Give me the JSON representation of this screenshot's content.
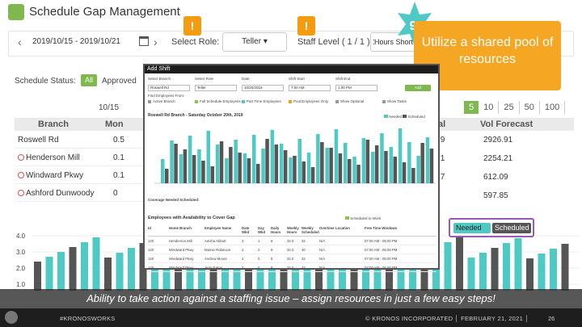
{
  "app": {
    "title": "Schedule Gap Management"
  },
  "toolbar": {
    "prev": "‹",
    "date_range": "2019/10/15 - 2019/10/21",
    "next": "›",
    "select_role_label": "Select Role:",
    "role_value": "Teller",
    "staff_level_label": "Staff Level ( 1 / 1 ) :",
    "hours_value": "Hours Short",
    "alert_glyph": "!"
  },
  "callout": {
    "step": "9",
    "text": "Utilize a shared pool of resources",
    "color": "#f5a623"
  },
  "status": {
    "label": "Schedule Status:",
    "all": "All",
    "approved": "Approved"
  },
  "pagination": {
    "options": [
      "5",
      "10",
      "25",
      "50",
      "100"
    ],
    "active": "5"
  },
  "branch_table": {
    "date_header": "10/15",
    "headers": {
      "branch": "Branch",
      "mon": "Mon"
    },
    "rows": [
      {
        "name": "Roswell Rd",
        "value": "0.5",
        "blocked": false
      },
      {
        "name": "Henderson Mill",
        "value": "0.1",
        "blocked": true
      },
      {
        "name": "Windward Pkwy",
        "value": "0.1",
        "blocked": true
      },
      {
        "name": "Ashford Dunwoody",
        "value": "0",
        "blocked": true
      }
    ]
  },
  "right_table": {
    "headers": {
      "col_a": "al",
      "col_b": "Vol Forecast"
    },
    "rows": [
      {
        "a": ".9",
        "b": "2926.91"
      },
      {
        "a": ".1",
        "b": "2254.21"
      },
      {
        "a": ".7",
        "b": "612.09"
      },
      {
        "a": "",
        "b": "597.85"
      }
    ]
  },
  "bg_chart": {
    "y_ticks": [
      "4.0",
      "3.0",
      "2.0",
      "1.0"
    ],
    "legend": {
      "needed": "Needed",
      "scheduled": "Scheduled"
    },
    "colors": {
      "needed": "#4ec9c4",
      "scheduled": "#555555"
    }
  },
  "add_shift": {
    "title": "Add Shift",
    "fields": [
      {
        "label": "Select Branch",
        "value": "Roswell Rd"
      },
      {
        "label": "Select Role",
        "value": "Teller"
      },
      {
        "label": "Date",
        "value": "10/20/2019"
      },
      {
        "label": "Shift Start",
        "value": "7:00 AM"
      },
      {
        "label": "Shift End",
        "value": "1:00 PM"
      }
    ],
    "add_button": "Add",
    "filter_label": "Find Employees From:",
    "chips": [
      "Active Branch",
      "Full Schedule Employees",
      "Part Time Employees",
      "Pool Employees Only",
      "Show Optional",
      "Show Tasks"
    ],
    "chart_title": "Roswell Rd Branch - Saturday October 20th, 2019",
    "legend": {
      "needed": "Needed",
      "scheduled": "Scheduled"
    },
    "coverage_title": "Coverage Needed Scheduled:",
    "avail_title": "Employees with Availability to Cover Gap",
    "avail_legend": "Scheduled to Work",
    "emp_headers": [
      "Id",
      "Home Branch",
      "Employee Name",
      "Date Wkd",
      "Day Wkd",
      "Daily Hours",
      "Weekly Hours",
      "Weekly Scheduled",
      "Overtime",
      "Location",
      "Free Time Windows"
    ],
    "employees": [
      [
        "120",
        "Henderson Mill",
        "Aeisha Abbott",
        "2",
        "1",
        "8",
        "32.0",
        "32",
        "N/A",
        "",
        "07:00 AM - 05:00 PM"
      ],
      [
        "120",
        "Windward Pkwy",
        "Mamie Robinson",
        "2",
        "2",
        "8",
        "32.0",
        "40",
        "N/A",
        "",
        "07:00 AM - 05:00 PM"
      ],
      [
        "120",
        "Windward Pkwy",
        "Andrew Moore",
        "2",
        "0",
        "8",
        "32.0",
        "32",
        "N/A",
        "",
        "07:00 AM - 05:00 PM"
      ],
      [
        "120",
        "Windward Pkwy",
        "Jerry Eaton",
        "2",
        "0",
        "8",
        "32.0",
        "32",
        "N/A",
        "",
        "07:00 AM - 05:00 PM"
      ]
    ]
  },
  "caption": "Ability to take action against a staffing issue – assign resources in just a few easy steps!",
  "footer": {
    "hashtag": "#KRONOSWORKS",
    "copyright": "© KRONOS INCORPORATED  │  FEBRUARY 21, 2021  │",
    "page": "26"
  }
}
